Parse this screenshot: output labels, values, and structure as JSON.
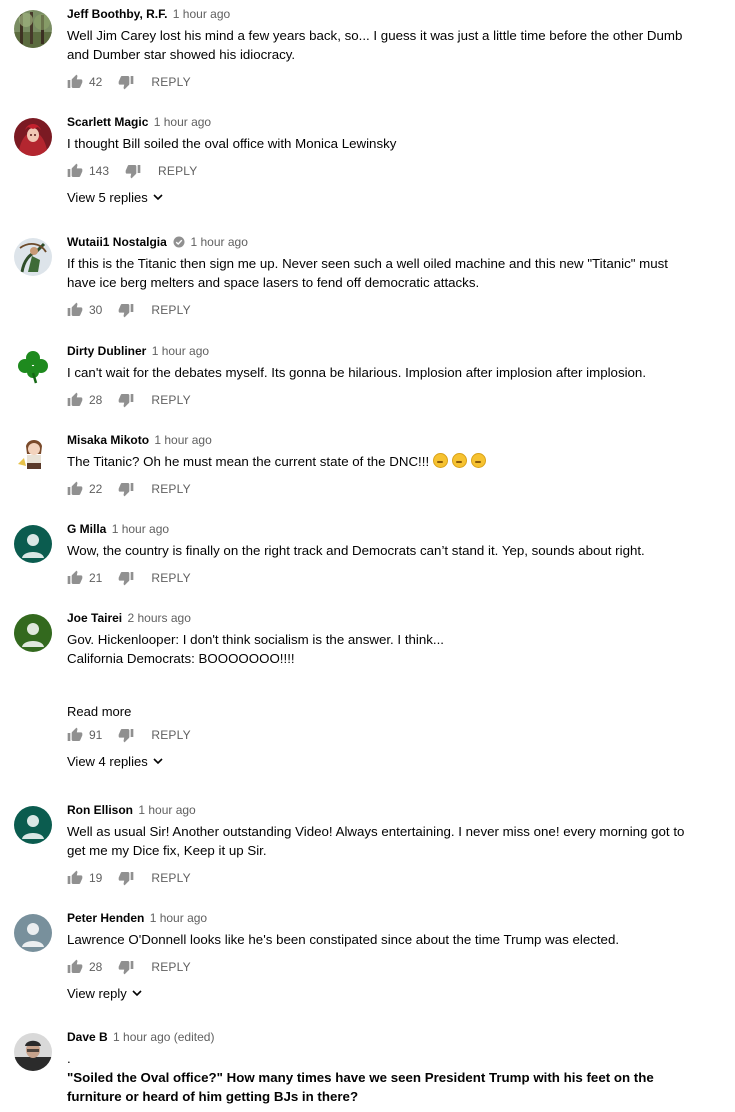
{
  "comments": [
    {
      "author": "Jeff Boothby, R.F.",
      "time": "1 hour ago",
      "text": [
        "Well Jim Carey lost his mind a few years back, so... I guess it was just a little time before the other Dumb and Dumber star showed his idiocracy."
      ],
      "likes": "42",
      "reply_label": "REPLY",
      "avatar": "forest-avatar",
      "verified": false,
      "emojis": 0,
      "read_more": "",
      "view_replies": ""
    },
    {
      "author": "Scarlett Magic",
      "time": "1 hour ago",
      "text": [
        "I thought Bill soiled the oval office with Monica Lewinsky"
      ],
      "likes": "143",
      "reply_label": "REPLY",
      "avatar": "red-character-avatar",
      "verified": false,
      "emojis": 0,
      "read_more": "",
      "view_replies": "View 5 replies"
    },
    {
      "author": "Wutaii1 Nostalgia",
      "time": "1 hour ago",
      "text": [
        "If this is the Titanic then sign me up.  Never seen such a well oiled machine and this new \"Titanic\" must have ice berg melters and space lasers to fend off democratic attacks."
      ],
      "likes": "30",
      "reply_label": "REPLY",
      "avatar": "archer-avatar",
      "verified": true,
      "emojis": 0,
      "read_more": "",
      "view_replies": ""
    },
    {
      "author": "Dirty Dubliner",
      "time": "1 hour ago",
      "text": [
        "I can't wait for the debates myself. Its gonna be hilarious. Implosion after implosion after implosion."
      ],
      "likes": "28",
      "reply_label": "REPLY",
      "avatar": "shamrock-avatar",
      "verified": false,
      "emojis": 0,
      "read_more": "",
      "view_replies": ""
    },
    {
      "author": "Misaka Mikoto",
      "time": "1 hour ago",
      "text": [
        "The Titanic? Oh he must mean the current state of the DNC!!!"
      ],
      "likes": "22",
      "reply_label": "REPLY",
      "avatar": "anime-avatar",
      "verified": false,
      "emojis": 3,
      "read_more": "",
      "view_replies": ""
    },
    {
      "author": "G Milla",
      "time": "1 hour ago",
      "text": [
        "Wow, the country is finally on the right track and Democrats can’t stand it. Yep, sounds about right."
      ],
      "likes": "21",
      "reply_label": "REPLY",
      "avatar": "default-avatar-teal",
      "verified": false,
      "emojis": 0,
      "read_more": "",
      "view_replies": ""
    },
    {
      "author": "Joe Tairei",
      "time": "2 hours ago",
      "text": [
        "Gov. Hickenlooper:  I don't think socialism is the answer.  I think...",
        "California Democrats:  BOOOOOOO!!!!"
      ],
      "likes": "91",
      "reply_label": "REPLY",
      "avatar": "default-avatar-green",
      "verified": false,
      "emojis": 0,
      "read_more": "Read more",
      "view_replies": "View 4 replies"
    },
    {
      "author": "Ron Ellison",
      "time": "1 hour ago",
      "text": [
        "Well as usual Sir! Another outstanding Video! Always entertaining. I never miss one! every morning got to get me my Dice fix, Keep it up Sir."
      ],
      "likes": "19",
      "reply_label": "REPLY",
      "avatar": "default-avatar-teal",
      "verified": false,
      "emojis": 0,
      "read_more": "",
      "view_replies": ""
    },
    {
      "author": "Peter Henden",
      "time": "1 hour ago",
      "text": [
        "Lawrence O'Donnell looks like he's been constipated since about the time Trump was elected."
      ],
      "likes": "28",
      "reply_label": "REPLY",
      "avatar": "default-avatar-gray",
      "verified": false,
      "emojis": 0,
      "read_more": "",
      "view_replies": "View reply"
    },
    {
      "author": "Dave B",
      "time": "1 hour ago (edited)",
      "text": [
        ".",
        "\"Soiled the Oval office?\"  How many times have we seen President Trump with his feet on the furniture or heard of him getting BJs in there?"
      ],
      "likes": "",
      "reply_label": "",
      "avatar": "photo-avatar",
      "verified": false,
      "emojis": 0,
      "read_more": "",
      "view_replies": ""
    }
  ],
  "colors": {
    "text": "#030303",
    "secondary": "#606060",
    "avatar_teal": "#0b5c4f",
    "avatar_green": "#33691e",
    "avatar_gray": "#78909c"
  }
}
